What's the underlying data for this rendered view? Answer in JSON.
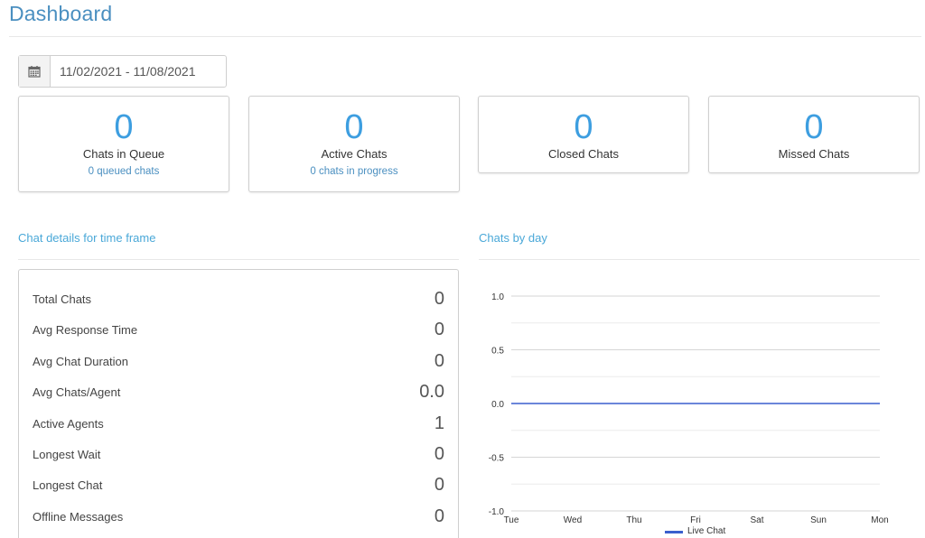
{
  "header": {
    "title": "Dashboard"
  },
  "date_range": {
    "value": "11/02/2021 - 11/08/2021"
  },
  "cards": [
    {
      "value": "0",
      "label": "Chats in Queue",
      "sub": "0 queued chats"
    },
    {
      "value": "0",
      "label": "Active Chats",
      "sub": "0 chats in progress"
    },
    {
      "value": "0",
      "label": "Closed Chats"
    },
    {
      "value": "0",
      "label": "Missed Chats"
    }
  ],
  "details": {
    "title": "Chat details for time frame",
    "rows": [
      {
        "label": "Total Chats",
        "value": "0"
      },
      {
        "label": "Avg Response Time",
        "value": "0"
      },
      {
        "label": "Avg Chat Duration",
        "value": "0"
      },
      {
        "label": "Avg Chats/Agent",
        "value": "0.0"
      },
      {
        "label": "Active Agents",
        "value": "1"
      },
      {
        "label": "Longest Wait",
        "value": "0"
      },
      {
        "label": "Longest Chat",
        "value": "0"
      },
      {
        "label": "Offline Messages",
        "value": "0"
      }
    ]
  },
  "chart_section": {
    "title": "Chats by day"
  },
  "colors": {
    "accent": "#3d9ee0",
    "series": "#3a5fcd"
  },
  "chart_data": {
    "type": "line",
    "categories": [
      "Tue",
      "Wed",
      "Thu",
      "Fri",
      "Sat",
      "Sun",
      "Mon"
    ],
    "series": [
      {
        "name": "Live Chat",
        "values": [
          0,
          0,
          0,
          0,
          0,
          0,
          0
        ]
      }
    ],
    "ylim": [
      -1.0,
      1.0
    ],
    "yticks": [
      "1.0",
      "0.5",
      "0.0",
      "-0.5",
      "-1.0"
    ],
    "grid": true,
    "legend": "bottom"
  }
}
